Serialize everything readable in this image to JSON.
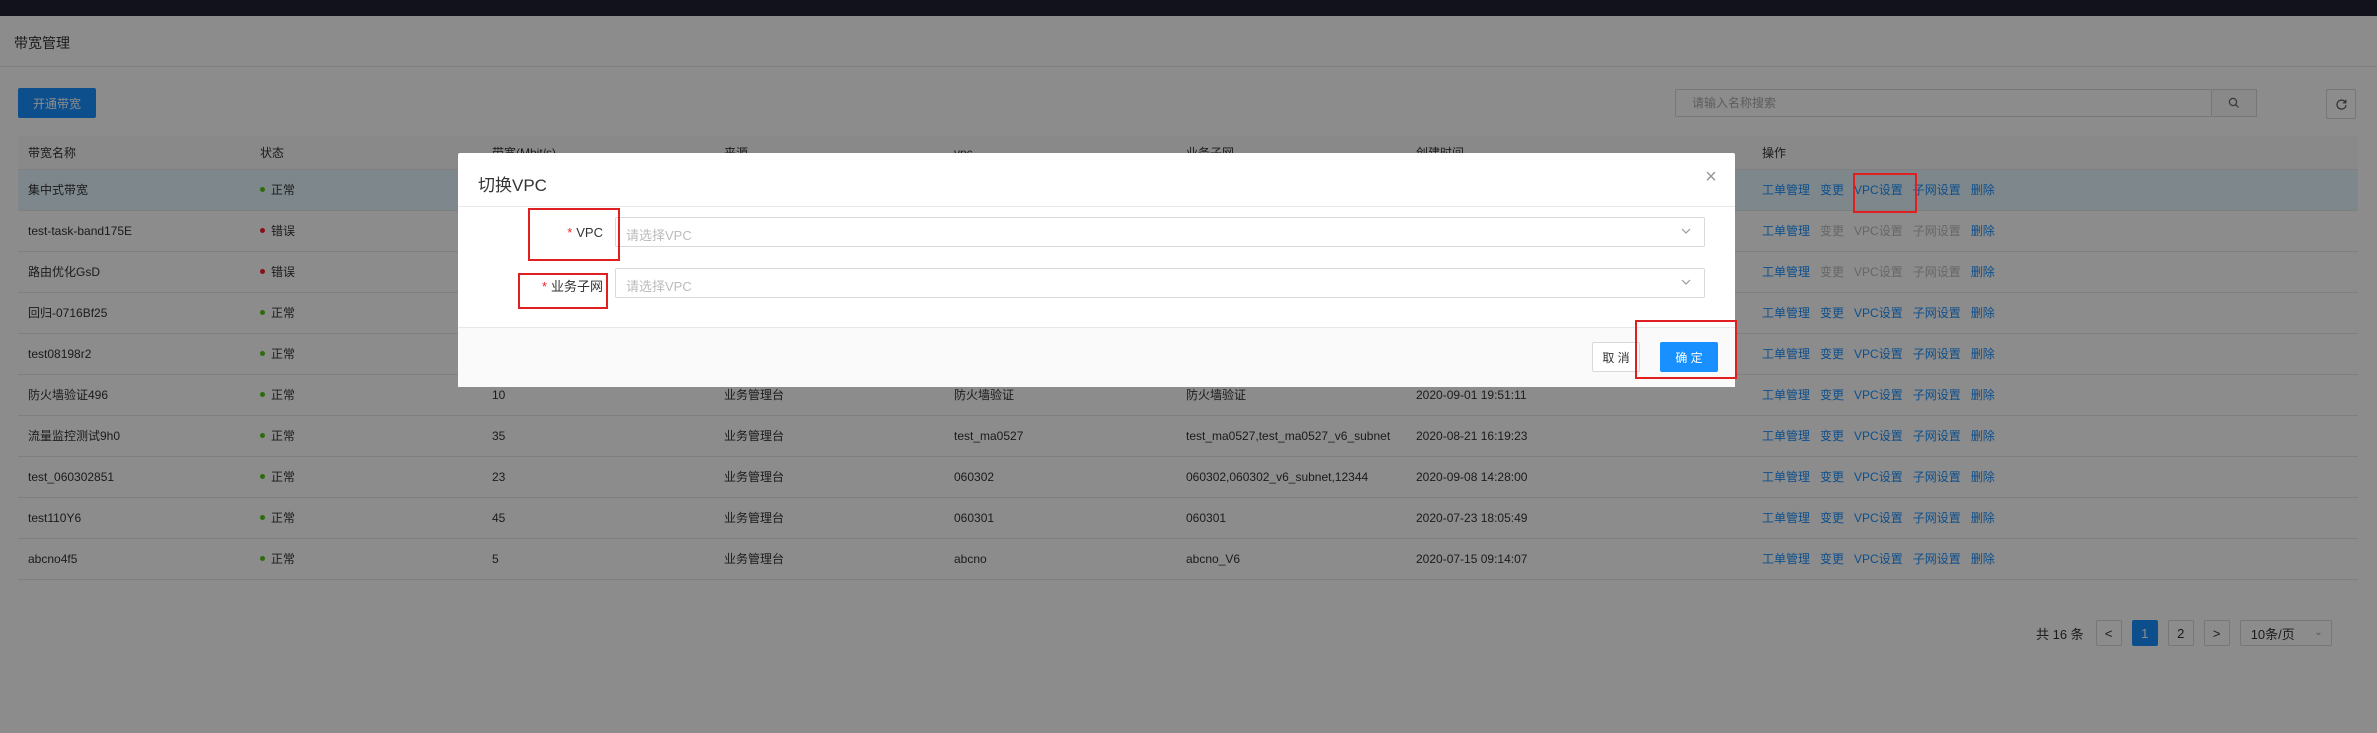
{
  "page": {
    "title": "带宽管理",
    "open_button": "开通带宽",
    "search_placeholder": "请输入名称搜索"
  },
  "table": {
    "headers": [
      "带宽名称",
      "状态",
      "带宽(Mbit/s)",
      "来源",
      "vpc",
      "业务子网",
      "创建时间",
      "操作"
    ],
    "rows": [
      {
        "name": "集中式带宽",
        "status": "正常",
        "status_type": "ok",
        "bw": "",
        "src": "",
        "vpc": "",
        "subnet": "",
        "time": "",
        "ops_disabled": false
      },
      {
        "name": "test-task-band175E",
        "status": "错误",
        "status_type": "err",
        "bw": "",
        "src": "",
        "vpc": "",
        "subnet": "",
        "time": "",
        "ops_disabled": true
      },
      {
        "name": "路由优化GsD",
        "status": "错误",
        "status_type": "err",
        "bw": "",
        "src": "",
        "vpc": "",
        "subnet": "",
        "time": "",
        "ops_disabled": true
      },
      {
        "name": "回归-0716Bf25",
        "status": "正常",
        "status_type": "ok",
        "bw": "",
        "src": "",
        "vpc": "",
        "subnet": "",
        "time": "",
        "ops_disabled": false
      },
      {
        "name": "test08198r2",
        "status": "正常",
        "status_type": "ok",
        "bw": "",
        "src": "",
        "vpc": "",
        "subnet": "",
        "time": "",
        "ops_disabled": false
      },
      {
        "name": "防火墙验证496",
        "status": "正常",
        "status_type": "ok",
        "bw": "10",
        "src": "业务管理台",
        "vpc": "防火墙验证",
        "subnet": "防火墙验证",
        "time": "2020-09-01 19:51:11",
        "ops_disabled": false
      },
      {
        "name": "流量监控测试9h0",
        "status": "正常",
        "status_type": "ok",
        "bw": "35",
        "src": "业务管理台",
        "vpc": "test_ma0527",
        "subnet": "test_ma0527,test_ma0527_v6_subnet",
        "time": "2020-08-21 16:19:23",
        "ops_disabled": false
      },
      {
        "name": "test_060302851",
        "status": "正常",
        "status_type": "ok",
        "bw": "23",
        "src": "业务管理台",
        "vpc": "060302",
        "subnet": "060302,060302_v6_subnet,12344",
        "time": "2020-09-08 14:28:00",
        "ops_disabled": false
      },
      {
        "name": "test110Y6",
        "status": "正常",
        "status_type": "ok",
        "bw": "45",
        "src": "业务管理台",
        "vpc": "060301",
        "subnet": "060301",
        "time": "2020-07-23 18:05:49",
        "ops_disabled": false
      },
      {
        "name": "abcno4f5",
        "status": "正常",
        "status_type": "ok",
        "bw": "5",
        "src": "业务管理台",
        "vpc": "abcno",
        "subnet": "abcno_V6",
        "time": "2020-07-15 09:14:07",
        "ops_disabled": false
      }
    ],
    "ops": [
      "工单管理",
      "变更",
      "VPC设置",
      "子网设置",
      "删除"
    ]
  },
  "pagination": {
    "total": "共 16 条",
    "pages": [
      "1",
      "2"
    ],
    "current": "1",
    "prev": "<",
    "next": ">",
    "page_size": "10条/页"
  },
  "modal": {
    "title": "切换VPC",
    "vpc_label": "VPC",
    "vpc_placeholder": "请选择VPC",
    "subnet_label": "业务子网",
    "subnet_placeholder": "请选择VPC",
    "required_mark": "*",
    "cancel": "取 消",
    "ok": "确 定"
  },
  "colors": {
    "primary": "#1890ff",
    "success": "#52c41a",
    "error": "#f5222d",
    "highlight": "#e02020"
  }
}
